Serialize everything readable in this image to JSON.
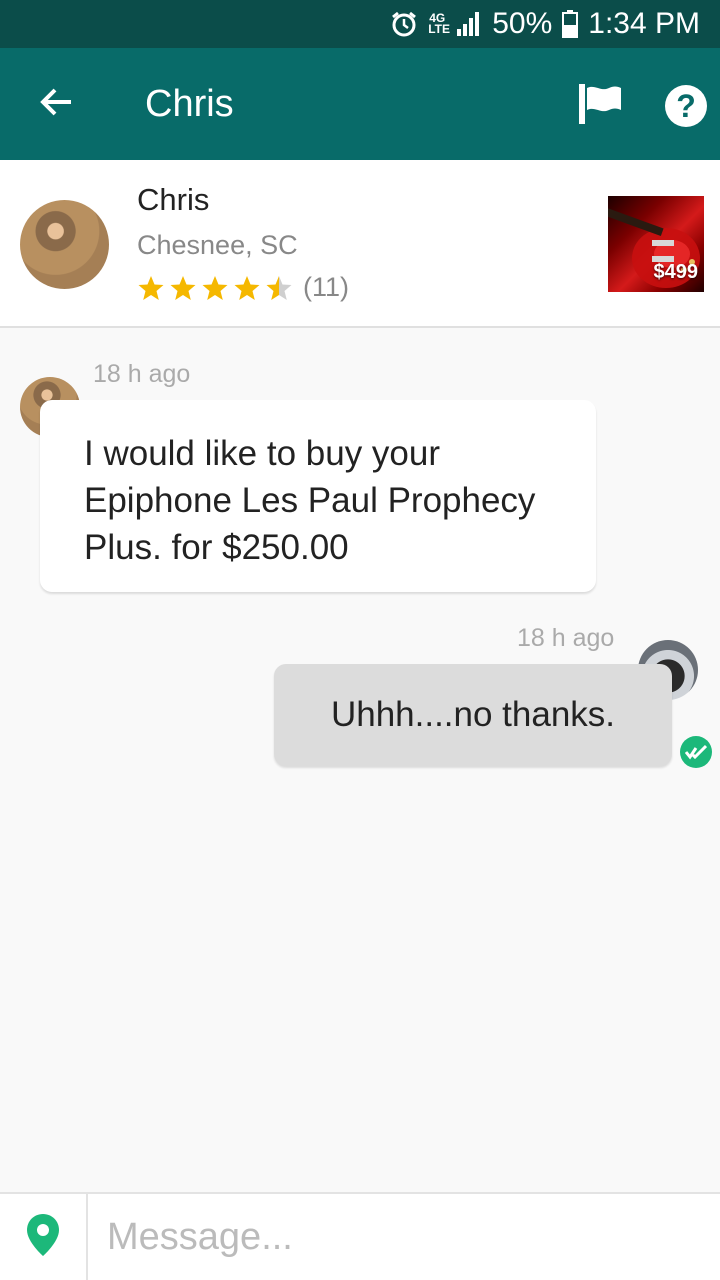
{
  "status_bar": {
    "network": "4G LTE",
    "battery": "50%",
    "time": "1:34 PM",
    "icons": [
      "alarm-icon",
      "lte-icon",
      "signal-icon",
      "battery-icon"
    ]
  },
  "app_bar": {
    "title": "Chris",
    "back_icon": "arrow-left-icon",
    "flag_icon": "flag-icon",
    "help_icon": "help-icon",
    "help_glyph": "?",
    "color": "#086b69"
  },
  "profile": {
    "name": "Chris",
    "location": "Chesnee, SC",
    "rating": 4.5,
    "rating_max": 5,
    "rating_count": "(11)",
    "star_color": "#f5b800"
  },
  "listing": {
    "price": "$499"
  },
  "messages": [
    {
      "direction": "incoming",
      "time": "18 h ago",
      "text": "I would like to buy your Epiphone Les Paul Prophecy Plus. for $250.00"
    },
    {
      "direction": "outgoing",
      "time": "18 h ago",
      "text": "Uhhh....no thanks.",
      "status_icon": "read-check-icon"
    }
  ],
  "composer": {
    "placeholder": "Message...",
    "location_icon": "location-pin-icon",
    "accent": "#1cb87a"
  }
}
